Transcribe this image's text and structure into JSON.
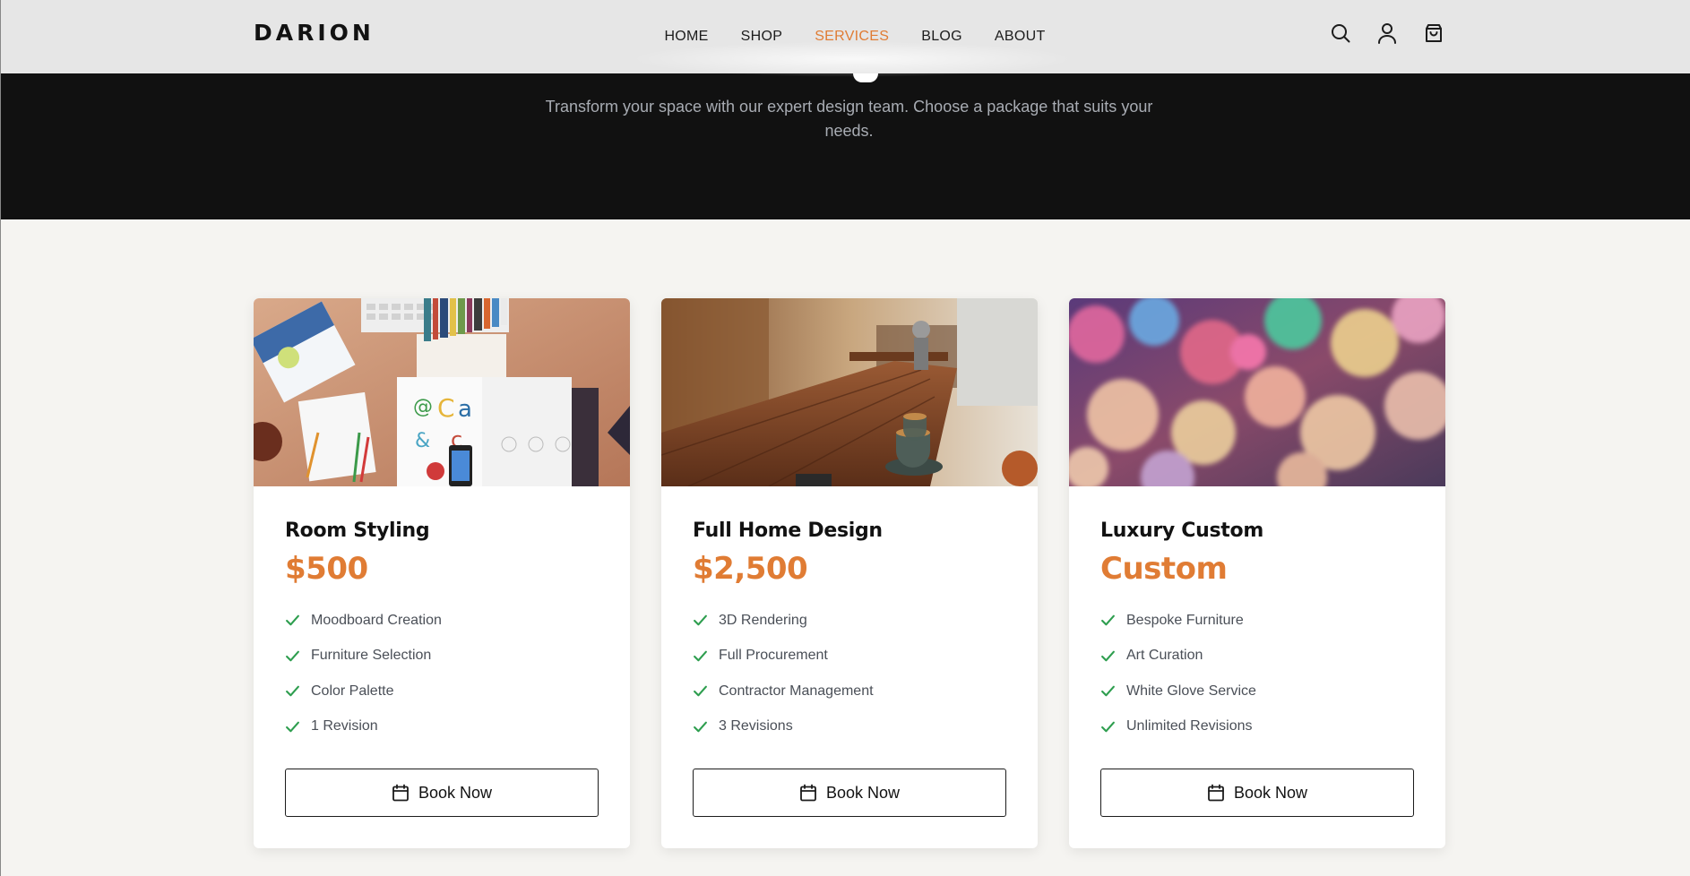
{
  "brand": {
    "logo": "DARION"
  },
  "nav": {
    "items": [
      {
        "label": "HOME"
      },
      {
        "label": "SHOP"
      },
      {
        "label": "SERVICES"
      },
      {
        "label": "BLOG"
      },
      {
        "label": "ABOUT"
      }
    ],
    "active": "SERVICES"
  },
  "header_icons": [
    "search-icon",
    "user-icon",
    "cart-icon"
  ],
  "hero": {
    "subtitle_line1": "Transform your space with our expert design team. Choose a package that suits your",
    "subtitle_line2": "needs."
  },
  "colors": {
    "accent": "#e07c34",
    "check": "#2e9e4f",
    "hero_bg": "#111111",
    "page_bg": "#f5f4f1"
  },
  "packages": [
    {
      "title": "Room Styling",
      "price": "$500",
      "image": "desk-with-magazines-photo",
      "features": [
        "Moodboard Creation",
        "Furniture Selection",
        "Color Palette",
        "1 Revision"
      ],
      "button": "Book Now"
    },
    {
      "title": "Full Home Design",
      "price": "$2,500",
      "image": "cafe-table-coffee-photo",
      "features": [
        "3D Rendering",
        "Full Procurement",
        "Contractor Management",
        "3 Revisions"
      ],
      "button": "Book Now"
    },
    {
      "title": "Luxury Custom",
      "price": "Custom",
      "image": "colorful-bokeh-photo",
      "features": [
        "Bespoke Furniture",
        "Art Curation",
        "White Glove Service",
        "Unlimited Revisions"
      ],
      "button": "Book Now"
    }
  ]
}
